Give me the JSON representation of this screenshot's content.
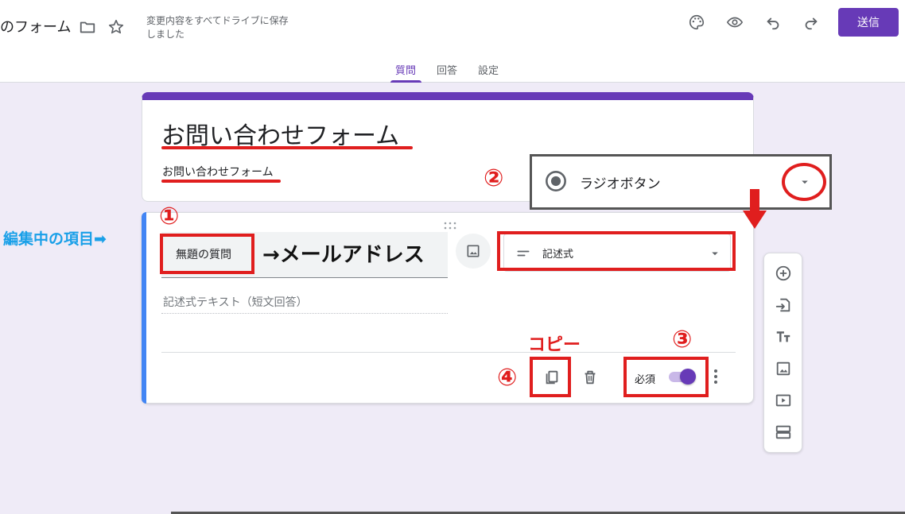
{
  "header": {
    "doc_title": "のフォーム",
    "save_status": "変更内容をすべてドライブに保存しました",
    "send_label": "送信"
  },
  "tabs": [
    {
      "label": "質問",
      "active": true
    },
    {
      "label": "回答",
      "active": false
    },
    {
      "label": "設定",
      "active": false
    }
  ],
  "form": {
    "title": "お問い合わせフォーム",
    "description": "お問い合わせフォーム"
  },
  "question": {
    "title": "無題の質問",
    "answer_placeholder": "記述式テキスト（短文回答）",
    "type": "記述式",
    "required_label": "必須",
    "required": true
  },
  "popup": {
    "type_option": "ラジオボタン"
  },
  "annotations": {
    "num1": "①",
    "num2": "②",
    "num3": "③",
    "num4": "④",
    "copy": "コピー",
    "arrow_text": "→メールアドレス",
    "editing_item": "編集中の項目➡"
  },
  "colors": {
    "accent": "#673ab7",
    "active_question": "#4285f4",
    "annotation_red": "#e01e1e",
    "annotation_blue": "#1aa0e8",
    "background": "#efebf7"
  },
  "icons": {
    "toolbar": [
      "folder-icon",
      "star-icon",
      "palette-icon",
      "preview-eye-icon",
      "undo-icon",
      "redo-icon"
    ],
    "side_toolbar": [
      "add-question-icon",
      "import-questions-icon",
      "add-title-icon",
      "add-image-icon",
      "add-video-icon",
      "add-section-icon"
    ]
  }
}
